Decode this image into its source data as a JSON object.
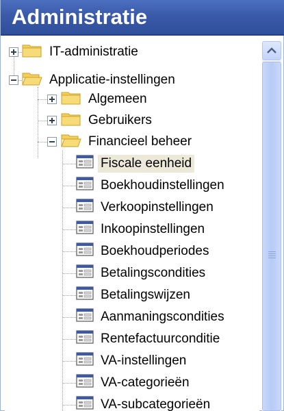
{
  "header": {
    "title": "Administratie"
  },
  "tree": {
    "nodes": [
      {
        "label": "IT-administratie",
        "type": "folder",
        "expander": "plus"
      },
      {
        "label": "Applicatie-instellingen",
        "type": "folder-open",
        "expander": "minus"
      },
      {
        "label": "Algemeen",
        "type": "folder",
        "expander": "plus"
      },
      {
        "label": "Gebruikers",
        "type": "folder",
        "expander": "plus"
      },
      {
        "label": "Financieel beheer",
        "type": "folder-open",
        "expander": "minus"
      },
      {
        "label": "Fiscale eenheid",
        "type": "form",
        "selected": true
      },
      {
        "label": "Boekhoudinstellingen",
        "type": "form"
      },
      {
        "label": "Verkoopinstellingen",
        "type": "form"
      },
      {
        "label": "Inkoopinstellingen",
        "type": "form"
      },
      {
        "label": "Boekhoudperiodes",
        "type": "form"
      },
      {
        "label": "Betalingscondities",
        "type": "form"
      },
      {
        "label": "Betalingswijzen",
        "type": "form"
      },
      {
        "label": "Aanmaningscondities",
        "type": "form"
      },
      {
        "label": "Rentefactuurconditie",
        "type": "form"
      },
      {
        "label": "VA-instellingen",
        "type": "form"
      },
      {
        "label": "VA-categorieën",
        "type": "form"
      },
      {
        "label": "VA-subcategorieën",
        "type": "form"
      }
    ]
  },
  "scrollbar": {
    "up_icon": "chevron-up-icon"
  },
  "colors": {
    "header_bg": "#3a5aa9",
    "selection_bg": "#ece9d8",
    "folder": "#f3cf5b",
    "scrollbar": "#c3d3fc"
  }
}
